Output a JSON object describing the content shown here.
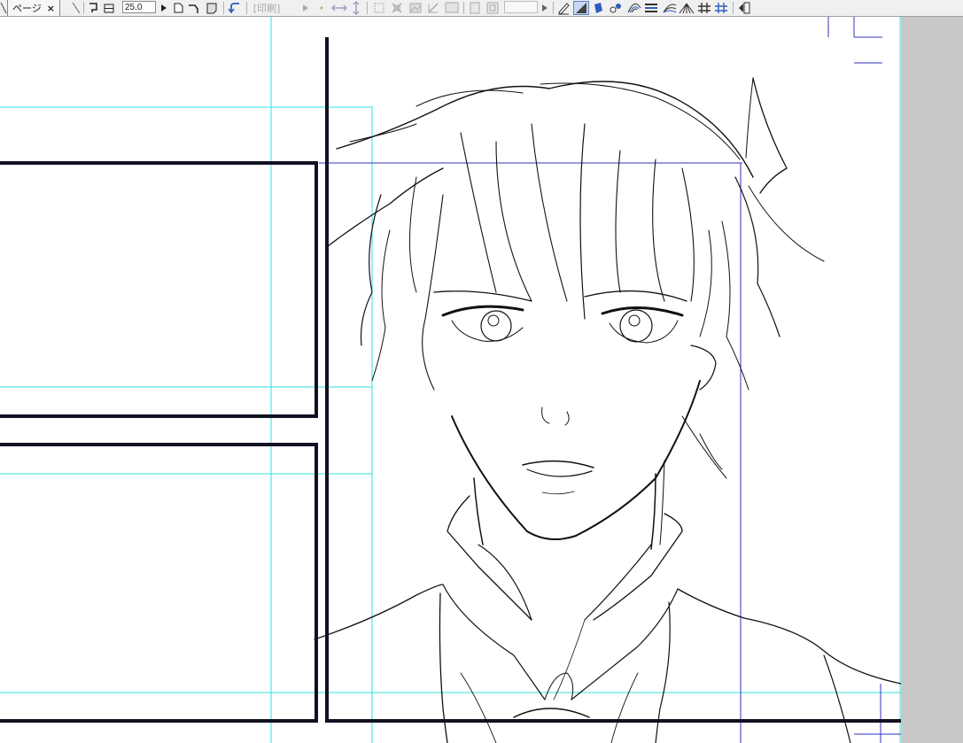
{
  "window": {
    "tab_label": "ページ",
    "tab_close": "×"
  },
  "toolbar": {
    "zoom_value": "25.0",
    "print_label": "[印刷]",
    "icons": [
      "page-layout-icon",
      "fit-icon",
      "new-page-icon",
      "turn-page-icon",
      "note-icon",
      "undo-icon",
      "play-left-icon",
      "play-right-icon",
      "flip-horizontal-icon",
      "flip-vertical-icon",
      "select-icon",
      "transform-icon",
      "pen-icon",
      "ruler-icon",
      "fill-icon",
      "color-icon",
      "spiral-icon",
      "lines-icon",
      "fan-icon",
      "grid-icon",
      "layer-panel-icon"
    ]
  },
  "colors": {
    "toolbar_bg": "#f0f0f0",
    "guide_cyan": "#33e0e0",
    "guide_blue": "#3030c0",
    "panel_border": "#111122",
    "margin_gray": "#c8c8c8"
  }
}
